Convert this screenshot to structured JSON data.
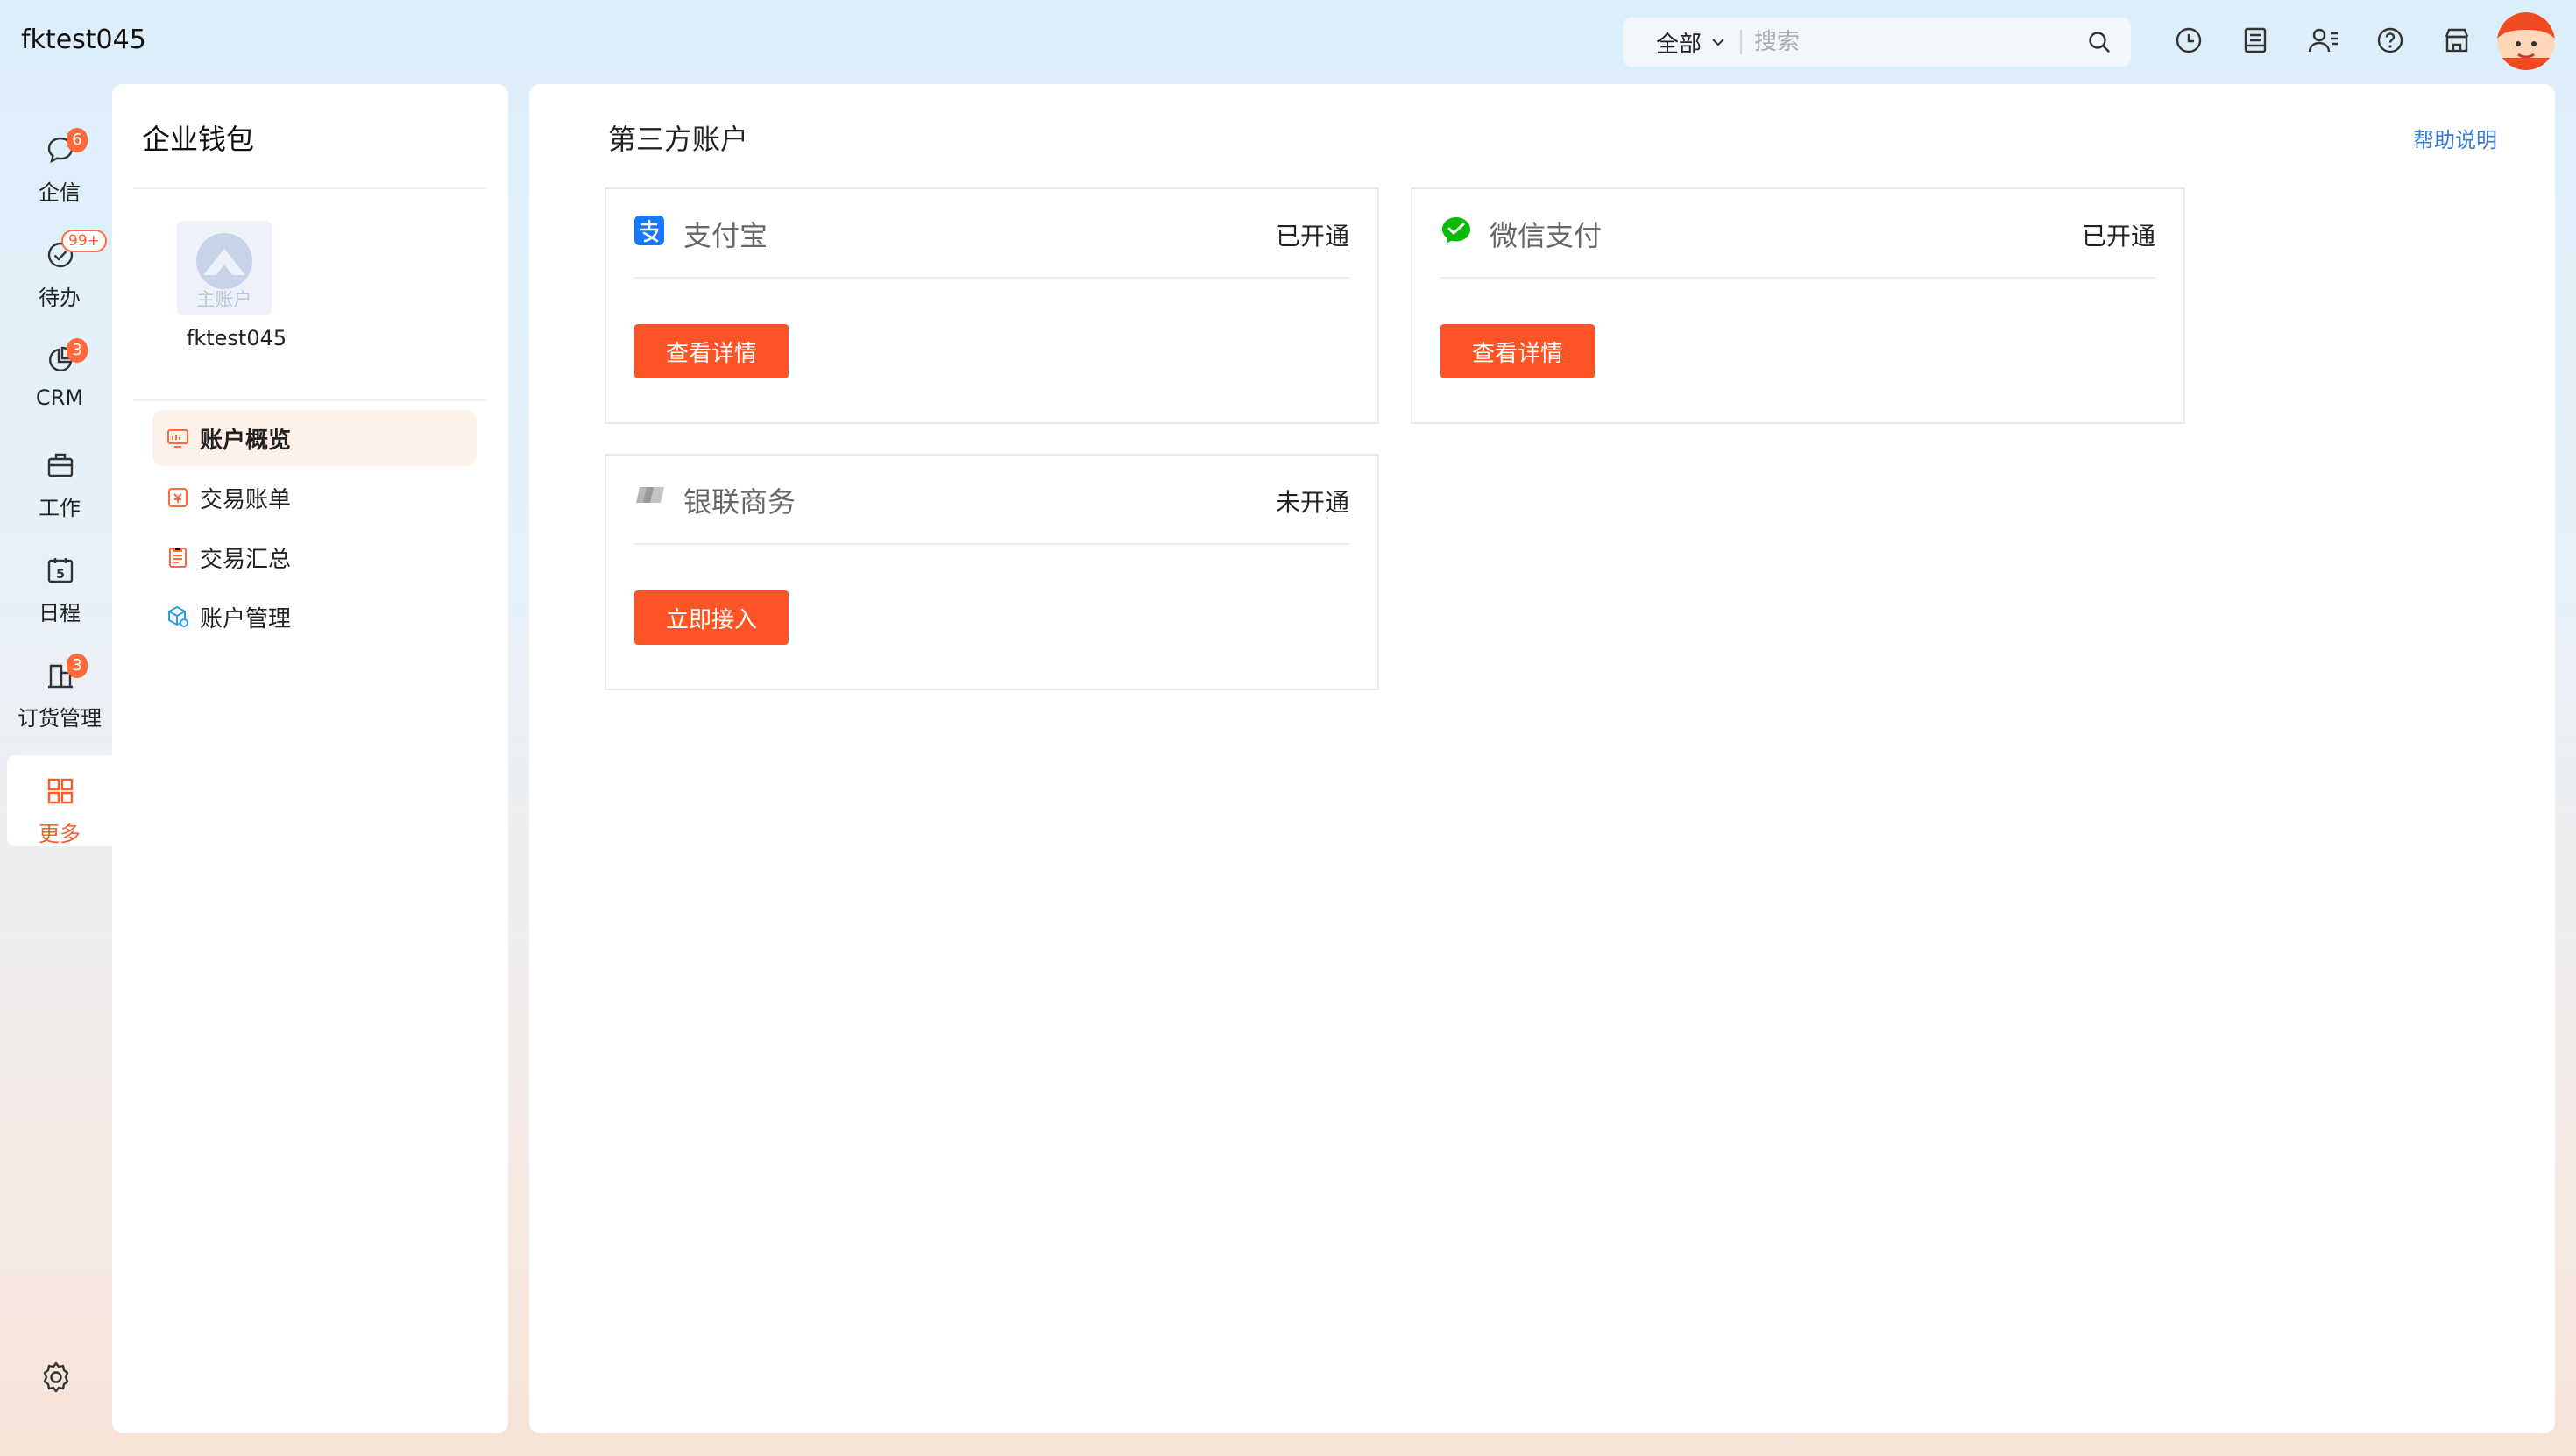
{
  "app": {
    "title": "fktest045"
  },
  "search": {
    "scope": "全部",
    "placeholder": "搜索"
  },
  "nav": {
    "items": [
      {
        "label": "企信",
        "badge": "6"
      },
      {
        "label": "待办",
        "badge": "99+"
      },
      {
        "label": "CRM",
        "badge": "3"
      },
      {
        "label": "工作",
        "badge": ""
      },
      {
        "label": "日程",
        "badge": ""
      },
      {
        "label": "订货管理",
        "badge": "3"
      },
      {
        "label": "更多",
        "badge": ""
      }
    ],
    "calendar_day": "5"
  },
  "wallet": {
    "title": "企业钱包",
    "account_logo_caption": "主账户",
    "account_name": "fktest045",
    "menu": [
      {
        "label": "账户概览"
      },
      {
        "label": "交易账单"
      },
      {
        "label": "交易汇总"
      },
      {
        "label": "账户管理"
      }
    ]
  },
  "main": {
    "title": "第三方账户",
    "help": "帮助说明",
    "cards": [
      {
        "name": "支付宝",
        "status": "已开通",
        "button": "查看详情"
      },
      {
        "name": "微信支付",
        "status": "已开通",
        "button": "查看详情"
      },
      {
        "name": "银联商务",
        "status": "未开通",
        "button": "立即接入"
      }
    ]
  },
  "colors": {
    "accent": "#ff5526",
    "badge": "#ff6a3d",
    "link": "#3a7bd5",
    "alipay": "#1677ff",
    "wechat": "#09bb07"
  }
}
